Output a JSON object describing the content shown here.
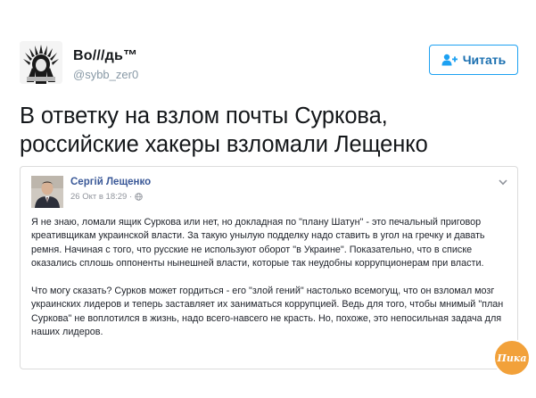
{
  "tweet": {
    "display_name": "Во///дь™",
    "handle": "@sybb_zer0",
    "follow_label": "Читать",
    "text_line1": "В ответку на взлом почты Суркова,",
    "text_line2": "российские хакеры взломали Лещенко"
  },
  "embedded_post": {
    "author": "Сергій Лещенко",
    "timestamp": "26 Окт в 18:29 ·",
    "paragraph1": "Я не знаю, ломали ящик Суркова или нет, но докладная по \"плану Шатун\" - это печальный приговор креативщикам украинской власти. За такую унылую подделку надо ставить в угол на гречку и давать ремня. Начиная с того, что русские не используют оборот \"в Украине\". Показательно, что в списке оказались сплошь оппоненты нынешней власти, которые так неудобны коррупционерам при власти.",
    "paragraph2": "Что могу сказать? Сурков может гордиться - его \"злой гений\" настолько всемогущ, что он взломал мозг украинских лидеров и теперь заставляет их заниматься коррупцией. Ведь для того, чтобы мнимый \"план Суркова\" не воплотился в жизнь, надо всего-навсего не красть. Но, похоже, это непосильная задача для наших лидеров."
  },
  "watermark": {
    "text": "Пика"
  },
  "icons": {
    "follow": "add-user-icon",
    "privacy": "globe-icon",
    "menu": "chevron-down-icon"
  },
  "colors": {
    "accent": "#1da1f2",
    "fb_link": "#3b5998",
    "handle": "#8899a6",
    "watermark": "#f2a13a"
  }
}
